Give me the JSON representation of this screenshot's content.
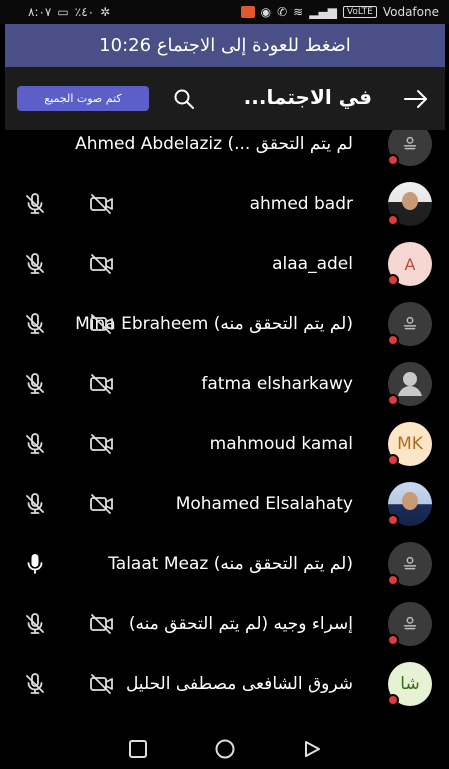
{
  "status_bar": {
    "time": "٨:٠٧",
    "battery": "٪٤٠",
    "carrier": "Vodafone",
    "chip": "VoLTE"
  },
  "banner": {
    "text": "اضغط للعودة إلى الاجتماع 10:26"
  },
  "header": {
    "title": "في الاجتما...",
    "mute_all_label": "كتم صوت الجميع",
    "search_icon": "search-icon",
    "back_icon": "arrow-right-icon"
  },
  "participants": [
    {
      "name": "لم يتم التحقق ...) Ahmed Abdelaziz",
      "avatar": "guest",
      "show_media": false,
      "mic": "none"
    },
    {
      "name": "ahmed badr",
      "avatar": "photo1",
      "show_media": true,
      "mic": "muted"
    },
    {
      "name": "alaa_adel",
      "avatar_initials": "A",
      "avatar": "initials-a",
      "show_media": true,
      "mic": "muted"
    },
    {
      "name": "(لم يتم التحقق منه) Mina Ebraheem",
      "avatar": "guest",
      "show_media": true,
      "mic": "muted"
    },
    {
      "name": "fatma elsharkawy",
      "avatar": "person",
      "show_media": true,
      "mic": "muted"
    },
    {
      "name": "mahmoud kamal",
      "avatar_initials": "MK",
      "avatar": "initials-mk",
      "show_media": true,
      "mic": "muted"
    },
    {
      "name": "Mohamed Elsalahaty",
      "avatar": "photo2",
      "show_media": true,
      "mic": "muted"
    },
    {
      "name": "(لم يتم التحقق منه) Talaat Meaz",
      "avatar": "guest",
      "show_media": true,
      "mic": "on"
    },
    {
      "name": "إسراء وجيه (لم يتم التحقق منه)",
      "avatar": "guest",
      "show_media": true,
      "mic": "muted"
    },
    {
      "name": "شروق الشافعى مصطفى الحليل",
      "avatar_initials": "شا",
      "avatar": "initials-sha",
      "show_media": true,
      "mic": "muted"
    }
  ],
  "nav": {
    "recents": "square-icon",
    "home": "circle-icon",
    "back": "triangle-icon"
  },
  "colors": {
    "banner": "#4a4f87",
    "accent": "#5b5fc7",
    "status_dot": "#e0393e"
  }
}
